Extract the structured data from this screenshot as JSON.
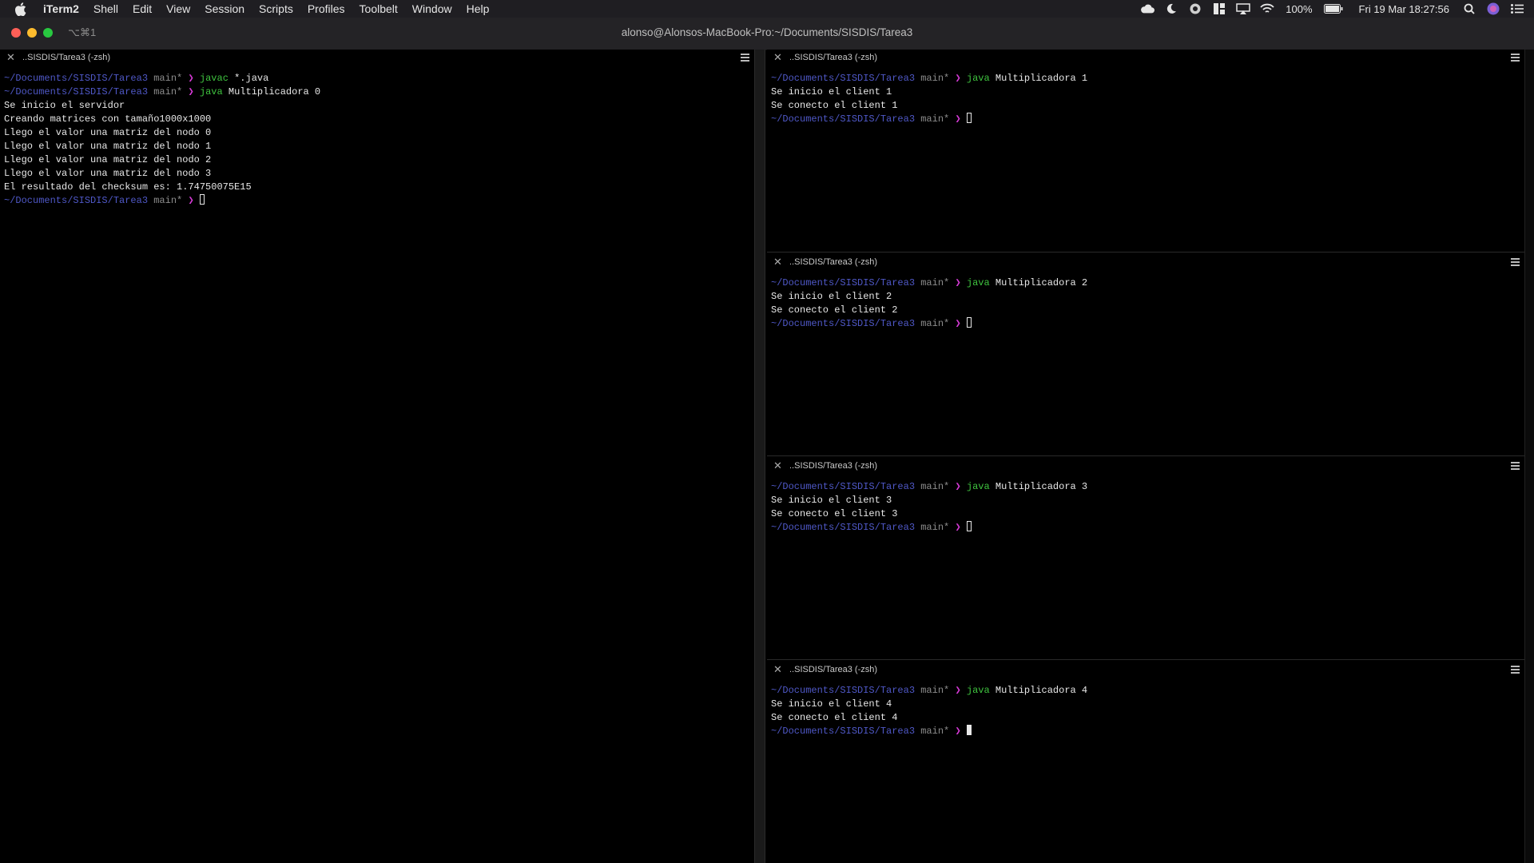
{
  "menubar": {
    "app_name": "iTerm2",
    "menus": [
      "Shell",
      "Edit",
      "View",
      "Session",
      "Scripts",
      "Profiles",
      "Toolbelt",
      "Window",
      "Help"
    ],
    "battery": "100%",
    "datetime": "Fri 19 Mar  18:27:56"
  },
  "window": {
    "shortcut": "⌥⌘1",
    "title": "alonso@Alonsos-MacBook-Pro:~/Documents/SISDIS/Tarea3"
  },
  "prompt": {
    "path": "~/Documents/SISDIS/Tarea3",
    "branch": "main*",
    "arrow": "❯"
  },
  "panes": [
    {
      "title": "..SISDIS/Tarea3 (-zsh)",
      "lines": [
        {
          "type": "prompt",
          "cmd": "javac",
          "args": " *.java"
        },
        {
          "type": "prompt",
          "cmd": "java",
          "args": " Multiplicadora 0"
        },
        {
          "type": "out",
          "text": "Se inicio el servidor"
        },
        {
          "type": "out",
          "text": "Creando matrices con tamaño1000x1000"
        },
        {
          "type": "out",
          "text": "Llego el valor una matriz del nodo 0"
        },
        {
          "type": "out",
          "text": "Llego el valor una matriz del nodo 1"
        },
        {
          "type": "out",
          "text": "Llego el valor una matriz del nodo 2"
        },
        {
          "type": "out",
          "text": "Llego el valor una matriz del nodo 3"
        },
        {
          "type": "out",
          "text": "El resultado del checksum es: 1.74750075E15"
        },
        {
          "type": "prompt-cursor"
        }
      ]
    },
    {
      "title": "..SISDIS/Tarea3 (-zsh)",
      "lines": [
        {
          "type": "prompt",
          "cmd": "java",
          "args": " Multiplicadora 1"
        },
        {
          "type": "out",
          "text": "Se inicio el client 1"
        },
        {
          "type": "out",
          "text": "Se conecto el client 1"
        },
        {
          "type": "prompt-cursor"
        }
      ]
    },
    {
      "title": "..SISDIS/Tarea3 (-zsh)",
      "lines": [
        {
          "type": "prompt",
          "cmd": "java",
          "args": " Multiplicadora 2"
        },
        {
          "type": "out",
          "text": "Se inicio el client 2"
        },
        {
          "type": "out",
          "text": "Se conecto el client 2"
        },
        {
          "type": "prompt-cursor"
        }
      ]
    },
    {
      "title": "..SISDIS/Tarea3 (-zsh)",
      "lines": [
        {
          "type": "prompt",
          "cmd": "java",
          "args": " Multiplicadora 3"
        },
        {
          "type": "out",
          "text": "Se inicio el client 3"
        },
        {
          "type": "out",
          "text": "Se conecto el client 3"
        },
        {
          "type": "prompt-cursor"
        }
      ]
    },
    {
      "title": "..SISDIS/Tarea3 (-zsh)",
      "lines": [
        {
          "type": "prompt",
          "cmd": "java",
          "args": " Multiplicadora 4"
        },
        {
          "type": "out",
          "text": "Se inicio el client 4"
        },
        {
          "type": "out",
          "text": "Se conecto el client 4"
        },
        {
          "type": "prompt-cursor",
          "active": true
        }
      ]
    }
  ]
}
